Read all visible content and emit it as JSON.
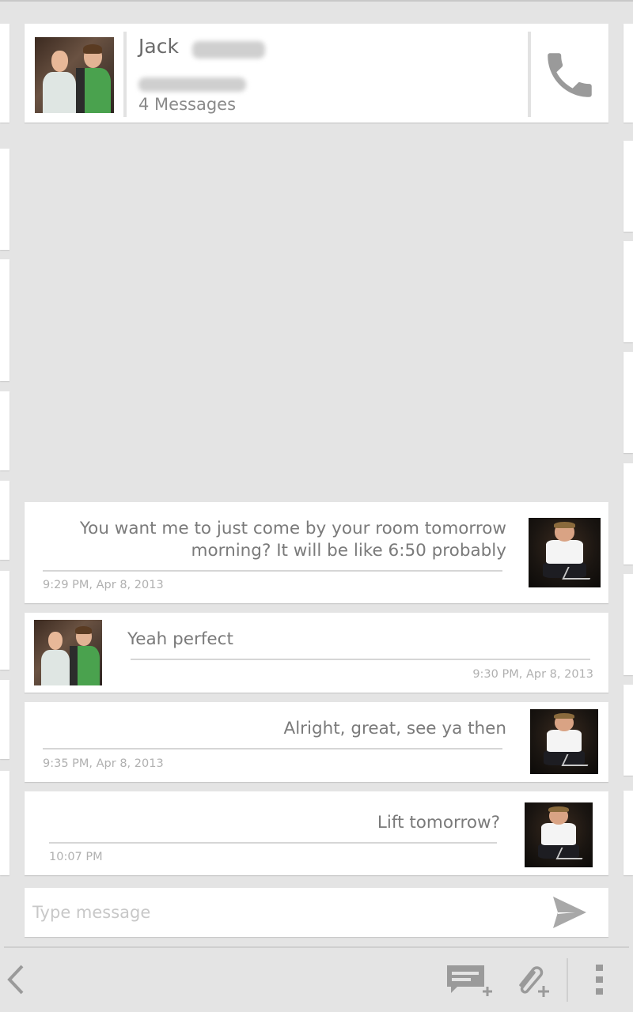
{
  "header": {
    "contact_first_name": "Jack",
    "message_count": "4 Messages"
  },
  "messages": [
    {
      "text": "You want me to just come by your room tomorrow morning? It will be like 6:50 probably",
      "time": "9:29 PM, Apr 8, 2013",
      "direction": "outgoing"
    },
    {
      "text": "Yeah perfect",
      "time": "9:30 PM, Apr 8, 2013",
      "direction": "incoming"
    },
    {
      "text": "Alright, great, see ya then",
      "time": "9:35 PM, Apr 8, 2013",
      "direction": "outgoing"
    },
    {
      "text": "Lift tomorrow?",
      "time": "10:07 PM",
      "direction": "outgoing"
    }
  ],
  "composer": {
    "placeholder": "Type message"
  },
  "icons": {
    "call": "phone-icon",
    "send": "send-icon",
    "back": "chevron-left-icon",
    "quick_text": "quick-text-icon",
    "attach": "paperclip-icon",
    "overflow": "overflow-menu-icon"
  },
  "colors": {
    "background": "#e4e4e4",
    "card": "#ffffff",
    "text": "#7a7a7a",
    "meta": "#b0b0b0",
    "icon": "#9a9a9a"
  }
}
